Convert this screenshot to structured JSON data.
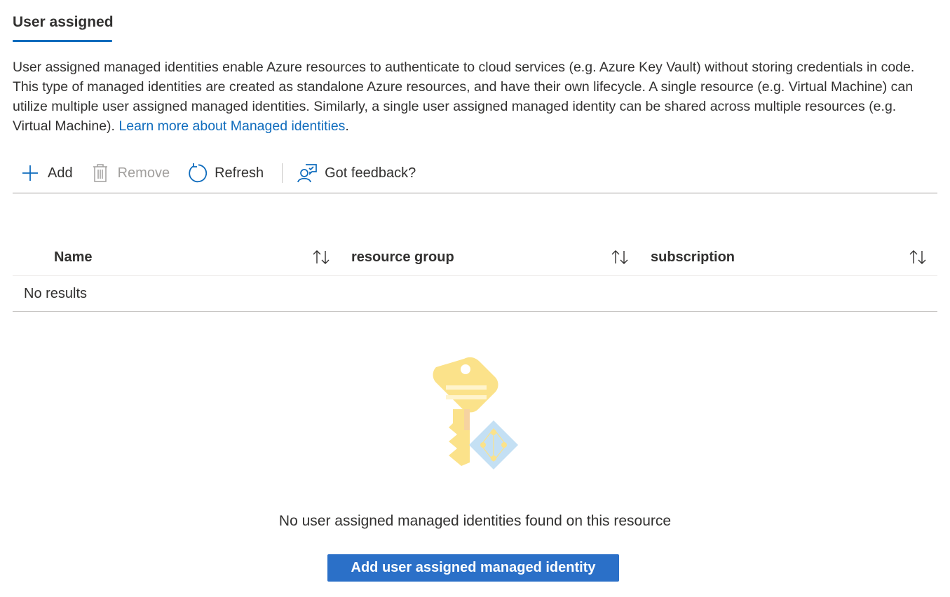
{
  "tab": {
    "label": "User assigned"
  },
  "description": {
    "text": "User assigned managed identities enable Azure resources to authenticate to cloud services (e.g. Azure Key Vault) without storing credentials in code. This type of managed identities are created as standalone Azure resources, and have their own lifecycle. A single resource (e.g. Virtual Machine) can utilize multiple user assigned managed identities. Similarly, a single user assigned managed identity can be shared across multiple resources (e.g. Virtual Machine). ",
    "link": "Learn more about Managed identities",
    "suffix": "."
  },
  "toolbar": {
    "add": {
      "label": "Add",
      "icon": "plus-icon"
    },
    "remove": {
      "label": "Remove",
      "icon": "trash-icon",
      "disabled": true
    },
    "refresh": {
      "label": "Refresh",
      "icon": "refresh-icon"
    },
    "feedback": {
      "label": "Got feedback?",
      "icon": "feedback-icon"
    }
  },
  "table": {
    "columns": [
      {
        "label": "Name",
        "icon": "sort-icon"
      },
      {
        "label": "resource group",
        "icon": "sort-icon"
      },
      {
        "label": "subscription",
        "icon": "sort-icon"
      }
    ],
    "empty_row": "No results"
  },
  "empty_state": {
    "icon": "key-identity-icon",
    "message": "No user assigned managed identities found on this resource",
    "button_label": "Add user assigned managed identity"
  },
  "colors": {
    "accent": "#0f6cbd",
    "primary_button": "#2b70c8",
    "key_yellow": "#fbe28a",
    "identity_blue": "#c4e0f4"
  }
}
